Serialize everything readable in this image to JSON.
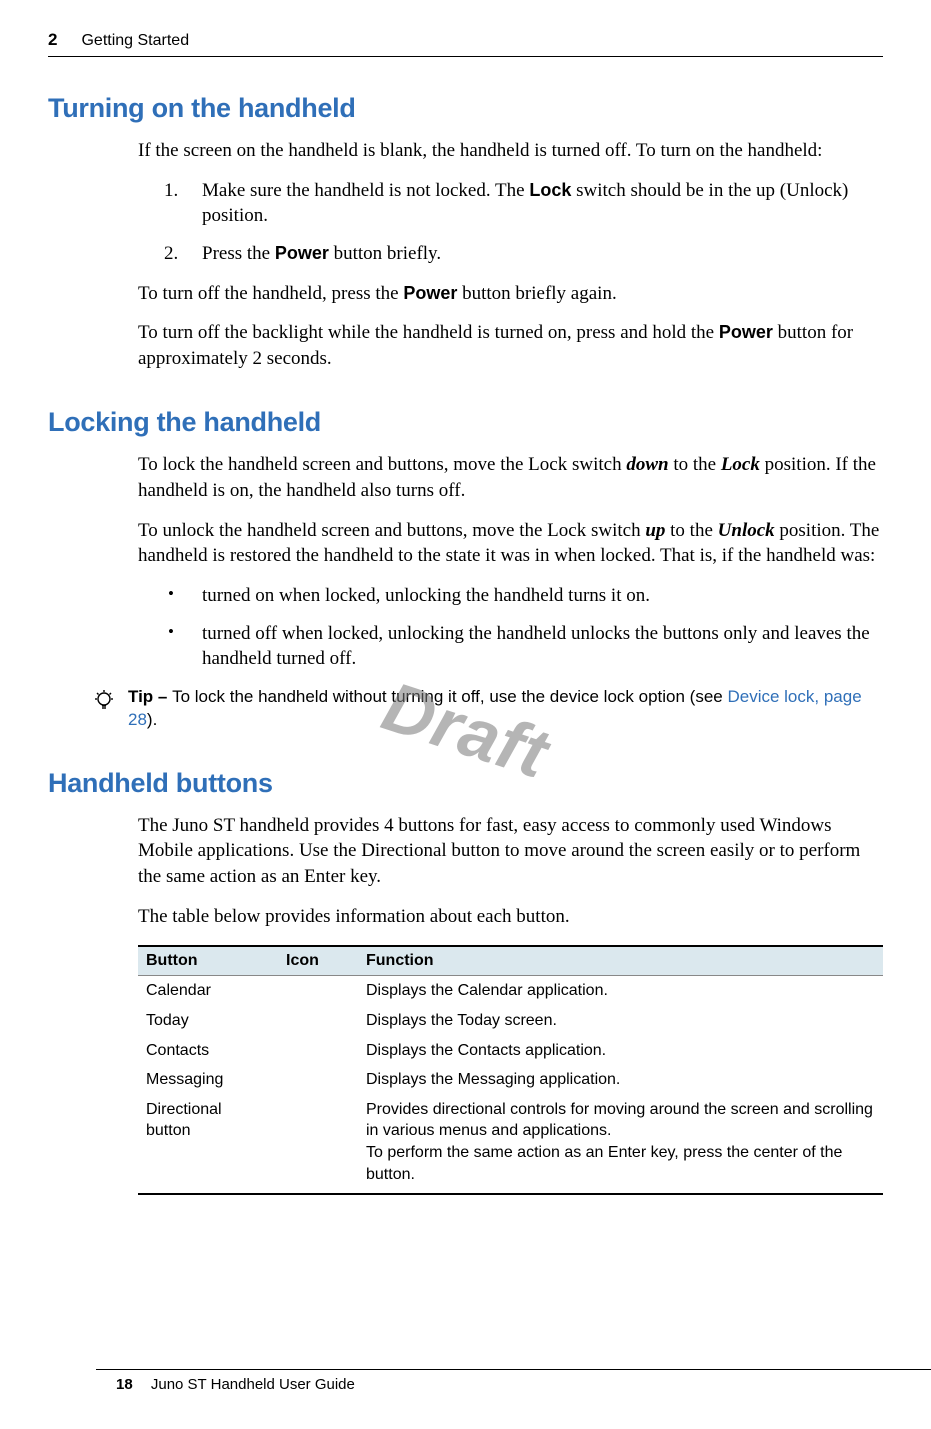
{
  "header": {
    "chapter_number": "2",
    "chapter_title": "Getting Started"
  },
  "watermark": "Draft",
  "sections": {
    "turning_on": {
      "heading": "Turning on the handheld",
      "intro": "If the screen on the handheld is blank, the handheld is turned off. To turn on the handheld:",
      "step1_a": "Make sure the handheld is not locked. The ",
      "step1_bold": "Lock",
      "step1_b": " switch should be in the up (Unlock) position.",
      "step2_a": "Press the ",
      "step2_bold": "Power",
      "step2_b": " button briefly.",
      "off_a": "To turn off the handheld, press the ",
      "off_bold": "Power",
      "off_b": " button briefly again.",
      "backlight_a": "To turn off the backlight while the handheld is turned on, press and hold the ",
      "backlight_bold": "Power",
      "backlight_b": " button for approximately 2 seconds."
    },
    "locking": {
      "heading": "Locking the handheld",
      "lock_a": "To lock the handheld screen and buttons, move the Lock switch ",
      "lock_down": "down",
      "lock_b": " to the ",
      "lock_pos": "Lock",
      "lock_c": " position. If the handheld is on, the handheld also turns off.",
      "unlock_a": "To unlock the handheld screen and buttons, move the Lock switch ",
      "unlock_up": "up",
      "unlock_b": " to the ",
      "unlock_pos": "Unlock",
      "unlock_c": " position. The handheld is restored the handheld to the state it was in when locked. That is, if the handheld was:",
      "bullet1": "turned on when locked, unlocking the handheld turns it on.",
      "bullet2": "turned off when locked, unlocking the handheld unlocks the buttons only and leaves the handheld turned off.",
      "tip_label": "Tip – ",
      "tip_text": "To lock the handheld without turning it off, use the device lock option (see ",
      "tip_link": "Device lock, page 28",
      "tip_close": ")."
    },
    "buttons": {
      "heading": "Handheld buttons",
      "para1": "The Juno ST handheld provides 4 buttons for fast, easy access to commonly used Windows Mobile applications. Use the Directional button to move around the screen easily or to perform the same action as an Enter key.",
      "para2": "The table below provides information about each button.",
      "th_button": "Button",
      "th_icon": "Icon",
      "th_function": "Function",
      "rows": [
        {
          "button": "Calendar",
          "function": "Displays the Calendar application."
        },
        {
          "button": "Today",
          "function": "Displays the Today screen."
        },
        {
          "button": "Contacts",
          "function": "Displays the Contacts application."
        },
        {
          "button": "Messaging",
          "function": "Displays the Messaging application."
        },
        {
          "button": "Directional button",
          "function": "Provides directional controls for moving around the screen and scrolling in various menus and applications."
        }
      ],
      "row5_extra": "To perform the same action as an Enter key, press the center of the button."
    }
  },
  "footer": {
    "page_number": "18",
    "doc_title": "Juno ST Handheld User Guide"
  }
}
